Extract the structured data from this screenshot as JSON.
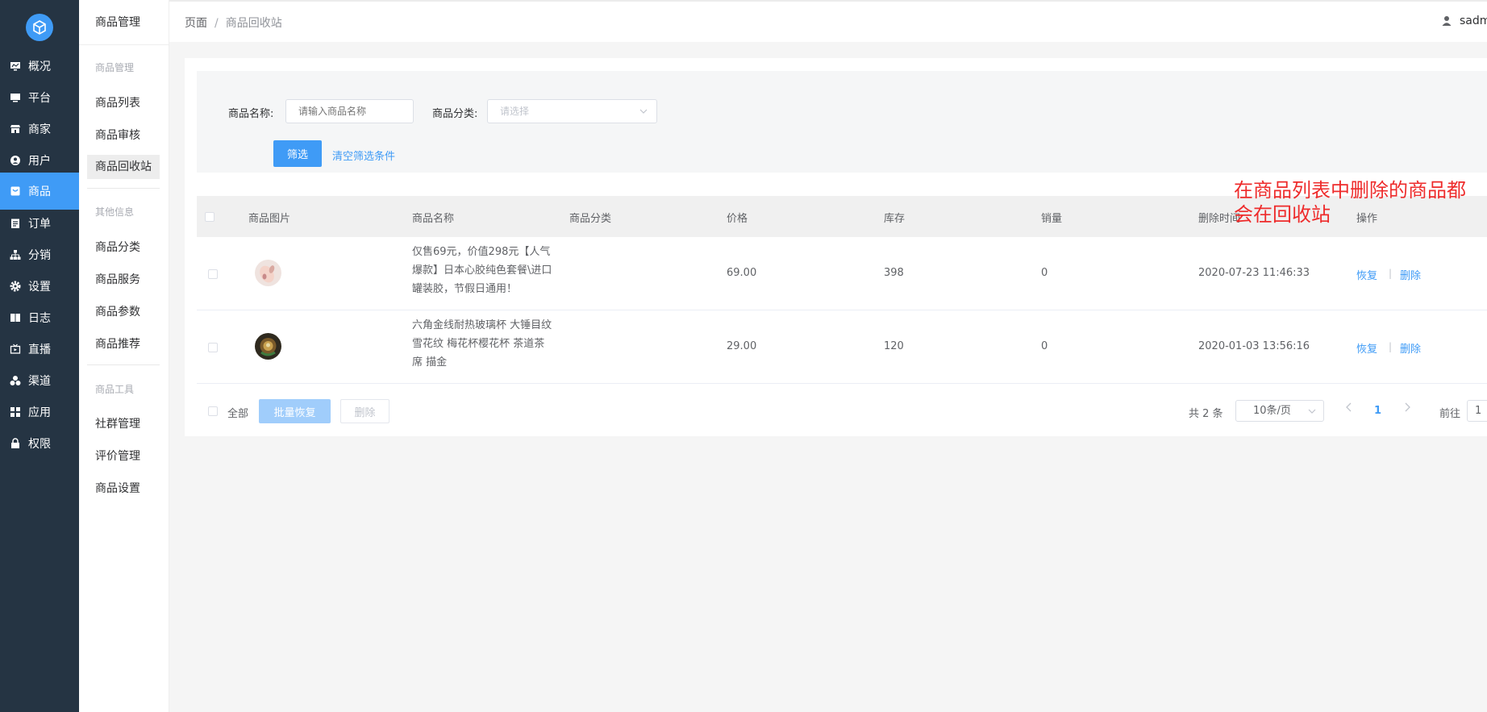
{
  "nav": {
    "items": [
      {
        "label": "概况",
        "icon": "monitor-chart-icon"
      },
      {
        "label": "平台",
        "icon": "desktop-icon"
      },
      {
        "label": "商家",
        "icon": "store-icon"
      },
      {
        "label": "用户",
        "icon": "user-circle-icon"
      },
      {
        "label": "商品",
        "icon": "goods-bag-icon",
        "active": true
      },
      {
        "label": "订单",
        "icon": "clipboard-icon"
      },
      {
        "label": "分销",
        "icon": "network-icon"
      },
      {
        "label": "设置",
        "icon": "gear-icon"
      },
      {
        "label": "日志",
        "icon": "book-icon"
      },
      {
        "label": "直播",
        "icon": "tv-icon"
      },
      {
        "label": "渠道",
        "icon": "cluster-icon"
      },
      {
        "label": "应用",
        "icon": "grid-icon"
      },
      {
        "label": "权限",
        "icon": "lock-icon"
      }
    ]
  },
  "subnav": {
    "title": "商品管理",
    "groups": [
      {
        "title": "商品管理",
        "items": [
          "商品列表",
          "商品审核",
          "商品回收站"
        ]
      },
      {
        "title": "其他信息",
        "items": [
          "商品分类",
          "商品服务",
          "商品参数",
          "商品推荐"
        ]
      },
      {
        "title": "商品工具",
        "items": [
          "社群管理",
          "评价管理",
          "商品设置"
        ]
      }
    ],
    "active": "商品回收站"
  },
  "header": {
    "breadcrumb": [
      "页面",
      "商品回收站"
    ],
    "user": "sadm"
  },
  "filter": {
    "name_label": "商品名称:",
    "name_placeholder": "请输入商品名称",
    "category_label": "商品分类:",
    "category_placeholder": "请选择",
    "submit_label": "筛选",
    "clear_label": "清空筛选条件"
  },
  "table": {
    "columns": [
      "商品图片",
      "商品名称",
      "商品分类",
      "价格",
      "库存",
      "销量",
      "删除时间",
      "操作"
    ],
    "rows": [
      {
        "name": "仅售69元，价值298元【人气爆款】日本心胶纯色套餐\\进口罐装胶，节假日通用！",
        "category": "",
        "price": "69.00",
        "stock": "398",
        "sales": "0",
        "deleted_at": "2020-07-23 11:46:33",
        "actions": [
          "恢复",
          "删除"
        ]
      },
      {
        "name": "六角金线耐热玻璃杯 大锤目纹雪花纹 梅花杯樱花杯 茶道茶席 描金",
        "category": "",
        "price": "29.00",
        "stock": "120",
        "sales": "0",
        "deleted_at": "2020-01-03 13:56:16",
        "actions": [
          "恢复",
          "删除"
        ]
      }
    ]
  },
  "footer": {
    "select_all": "全部",
    "batch_restore": "批量恢复",
    "delete": "删除"
  },
  "pagination": {
    "total": "共 2 条",
    "page_size": "10条/页",
    "current": "1",
    "goto_label": "前往",
    "goto_value": "1"
  },
  "annotation": "在商品列表中删除的商品都会在回收站",
  "colors": {
    "nav_bg": "#253443",
    "primary": "#3f9bf6",
    "annotation": "#ee2b2b"
  }
}
